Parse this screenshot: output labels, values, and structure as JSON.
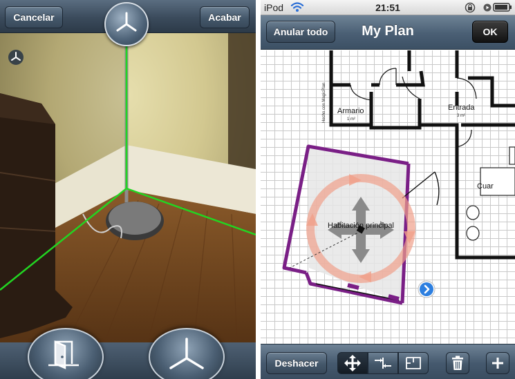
{
  "left_panel": {
    "cancel_label": "Cancelar",
    "finish_label": "Acabar",
    "icons": {
      "top_center": "corner-capture-icon",
      "small_marker": "corner-marker-icon",
      "bottom_left": "door-icon",
      "bottom_right": "corner-icon"
    },
    "guide_line_color": "#22d622"
  },
  "right_panel": {
    "status_bar": {
      "carrier": "iPod",
      "time": "21:51"
    },
    "nav": {
      "undo_all_label": "Anular todo",
      "title": "My Plan",
      "ok_label": "OK"
    },
    "plan": {
      "watermark": "Hecho con MagicPlan",
      "rooms": [
        {
          "name": "Armario",
          "area": "1 m²"
        },
        {
          "name": "Entrada",
          "area": "3 m²"
        },
        {
          "name": "Cuar",
          "area": ""
        },
        {
          "name": "Habitación principal",
          "area": ""
        }
      ],
      "selected_room_color": "#7a1f86",
      "move_ring_color": "#f0a08a"
    },
    "toolbar": {
      "undo_label": "Deshacer",
      "tools": [
        "move-icon",
        "split-wall-icon",
        "room-shape-icon",
        "trash-icon",
        "add-icon"
      ]
    }
  }
}
